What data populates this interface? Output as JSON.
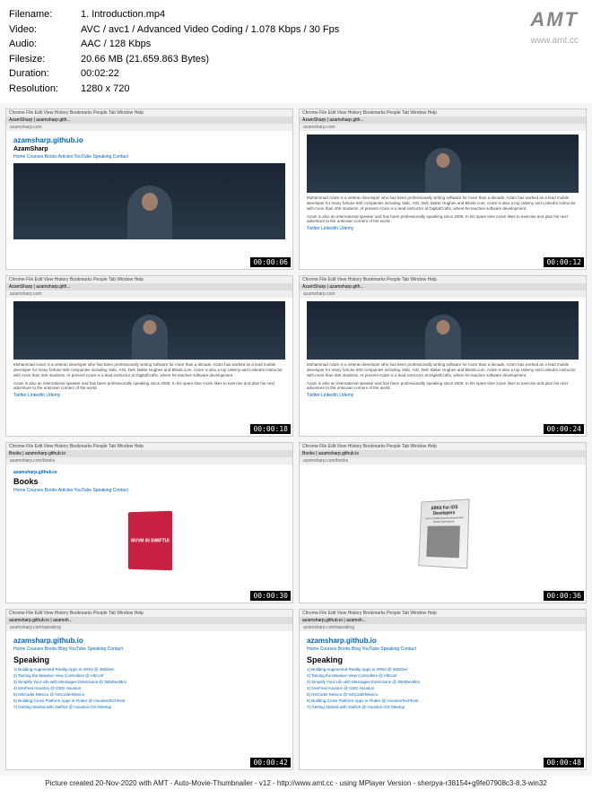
{
  "metadata": {
    "filename_label": "Filename:",
    "filename_value": "1. Introduction.mp4",
    "video_label": "Video:",
    "video_value": "AVC / avc1 / Advanced Video Coding / 1.078 Kbps / 30 Fps",
    "audio_label": "Audio:",
    "audio_value": "AAC / 128 Kbps",
    "filesize_label": "Filesize:",
    "filesize_value": "20.66 MB (21.659.863 Bytes)",
    "duration_label": "Duration:",
    "duration_value": "00:02:22",
    "resolution_label": "Resolution:",
    "resolution_value": "1280 x 720"
  },
  "watermark": {
    "logo": "AMT",
    "url": "www.amt.cc"
  },
  "common": {
    "menubar": "Chrome   File   Edit   View   History   Bookmarks   People   Tab   Window   Help",
    "site_title": "azamsharp.github.io",
    "author": "AzamSharp",
    "nav": "Home Courses Books Articles YouTube Speaking Contact",
    "nav2": "Home Courses Books Blog YouTube Speaking Contact",
    "bio": "Mohammad Azam is a veteran developer who has been professionally writing software for more than a decade. Azam has worked as a lead mobile developer for many fortune 500 companies including Valic, AIG, Dell, Baker Hughes and Blinds.com. Azam is also a top Udemy and LinkedIn instructor with more than 40K students. At present Azam is a lead instructor at DigitalCrafts, where he teaches software development.",
    "bio2": "Azam is also an international speaker and has been professionally speaking since 2006. In his spare time Azam likes to exercise and plan his next adventure to the unknown corners of the world.",
    "social": "Twitter LinkedIn Udemy",
    "url_home": "azamsharp.com",
    "url_books": "azamsharp.com/books",
    "url_speaking": "azamsharp.com/speaking",
    "tab_home": "AzamSharp | azamsharp.gith...",
    "tab_books": "Books | azamsharp.github.io",
    "tab_speaking": "azamsharp.github.io | azamsh..."
  },
  "books": {
    "heading": "Books",
    "book1_title": "MVVM IN SWIFTUI",
    "book2_title": "ARKit For iOS Developers",
    "book2_sub": "Learn to Build Amazing Augmented Reality Applications"
  },
  "speaking": {
    "heading": "Speaking",
    "items": [
      "1) Building Augmented Reality Apps in ARKit @ 360iDev",
      "2) Taming the Massive View Controllers @ AltConf",
      "3) Simplify Your Life with Messages Extensions @ 360iDevMini",
      "4) DevFest Houston @ GDG Houston",
      "5) NSCoder Mexico @ NSCoderMexico",
      "6) Building Cross Platform Apps in Flutter @ HoustonTechFest",
      "7) Getting Started with SwiftUI @ Houston iOS Meetup"
    ]
  },
  "timestamps": [
    "00:00:06",
    "00:00:12",
    "00:00:18",
    "00:00:24",
    "00:00:30",
    "00:00:36",
    "00:00:42",
    "00:00:48"
  ],
  "footer": "Picture created 20-Nov-2020 with AMT - Auto-Movie-Thumbnailer - v12 - http://www.amt.cc - using MPlayer Version - sherpya-r38154+g9fe07908c3-8.3-win32"
}
